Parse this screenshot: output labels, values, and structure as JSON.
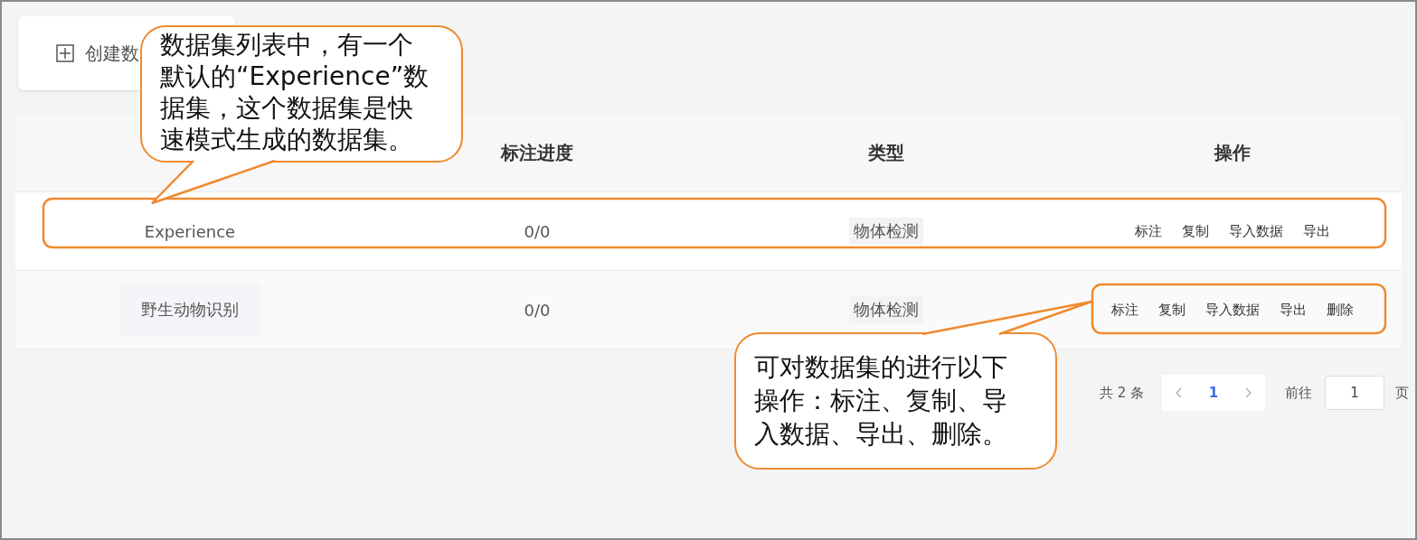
{
  "create_button": {
    "label": "创建数"
  },
  "table": {
    "columns": [
      "标注进度",
      "类型",
      "操作"
    ],
    "rows": [
      {
        "name": "Experience",
        "progress": "0/0",
        "type": "物体检测",
        "hovered": false,
        "actions": [
          "标注",
          "复制",
          "导入数据",
          "导出"
        ]
      },
      {
        "name": "野生动物识别",
        "progress": "0/0",
        "type": "物体检测",
        "hovered": true,
        "actions": [
          "标注",
          "复制",
          "导入数据",
          "导出",
          "删除"
        ]
      }
    ]
  },
  "pagination": {
    "total": "共 2 条",
    "pages": [
      {
        "label": "1",
        "selected": true
      }
    ],
    "goto_label": "前往",
    "goto_value": "1",
    "page_unit": "页"
  },
  "annotations": [
    {
      "text": "数据集列表中，有一个默认的“Experience”数据集，这个数据集是快速模式生成的数据集。"
    },
    {
      "text": "可对数据集的进行以下操作：标注、复制、导入数据、导出、删除。"
    }
  ]
}
